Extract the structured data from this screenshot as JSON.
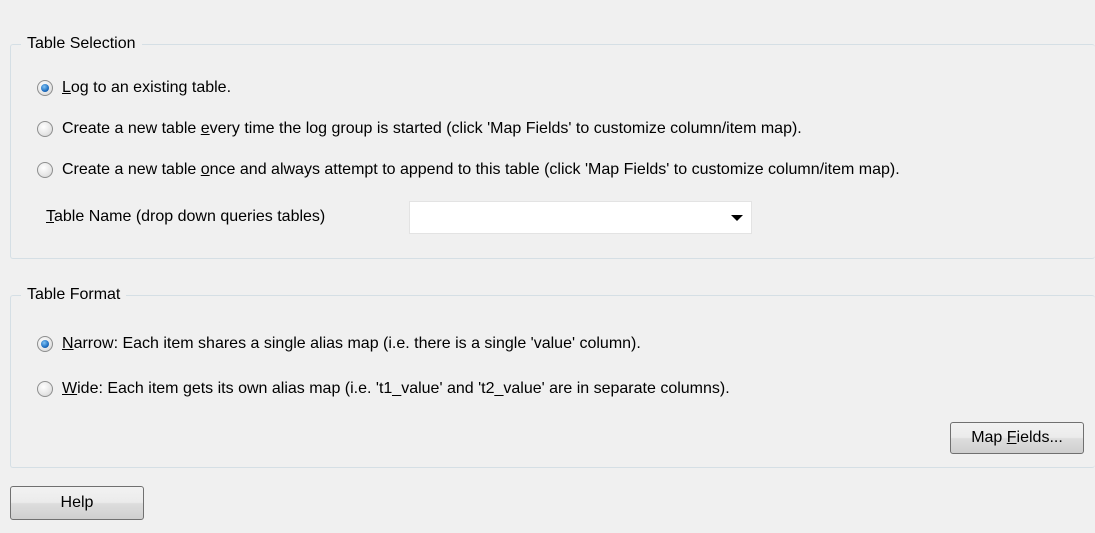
{
  "table_selection": {
    "title": "Table Selection",
    "options": [
      {
        "pre": "",
        "accel": "L",
        "post": "og to an existing table.",
        "checked": true
      },
      {
        "pre": "Create a new table ",
        "accel": "e",
        "post": "very time the log group is started (click 'Map Fields' to customize column/item map).",
        "checked": false
      },
      {
        "pre": "Create a new table ",
        "accel": "o",
        "post": "nce and always attempt to append to this table (click 'Map Fields' to customize column/item map).",
        "checked": false
      }
    ],
    "table_name_label": {
      "accel": "T",
      "post": "able Name (drop down queries tables)"
    },
    "table_name_value": ""
  },
  "table_format": {
    "title": "Table Format",
    "options": [
      {
        "accel": "N",
        "post": "arrow: Each item shares a single alias map (i.e. there is a single 'value' column).",
        "checked": true
      },
      {
        "accel": "W",
        "post": "ide: Each item gets its own alias map (i.e. 't1_value' and 't2_value' are in separate columns).",
        "checked": false
      }
    ],
    "map_fields_button": {
      "pre": "Map ",
      "accel": "F",
      "post": "ields..."
    }
  },
  "help_button": {
    "label": "Help"
  }
}
